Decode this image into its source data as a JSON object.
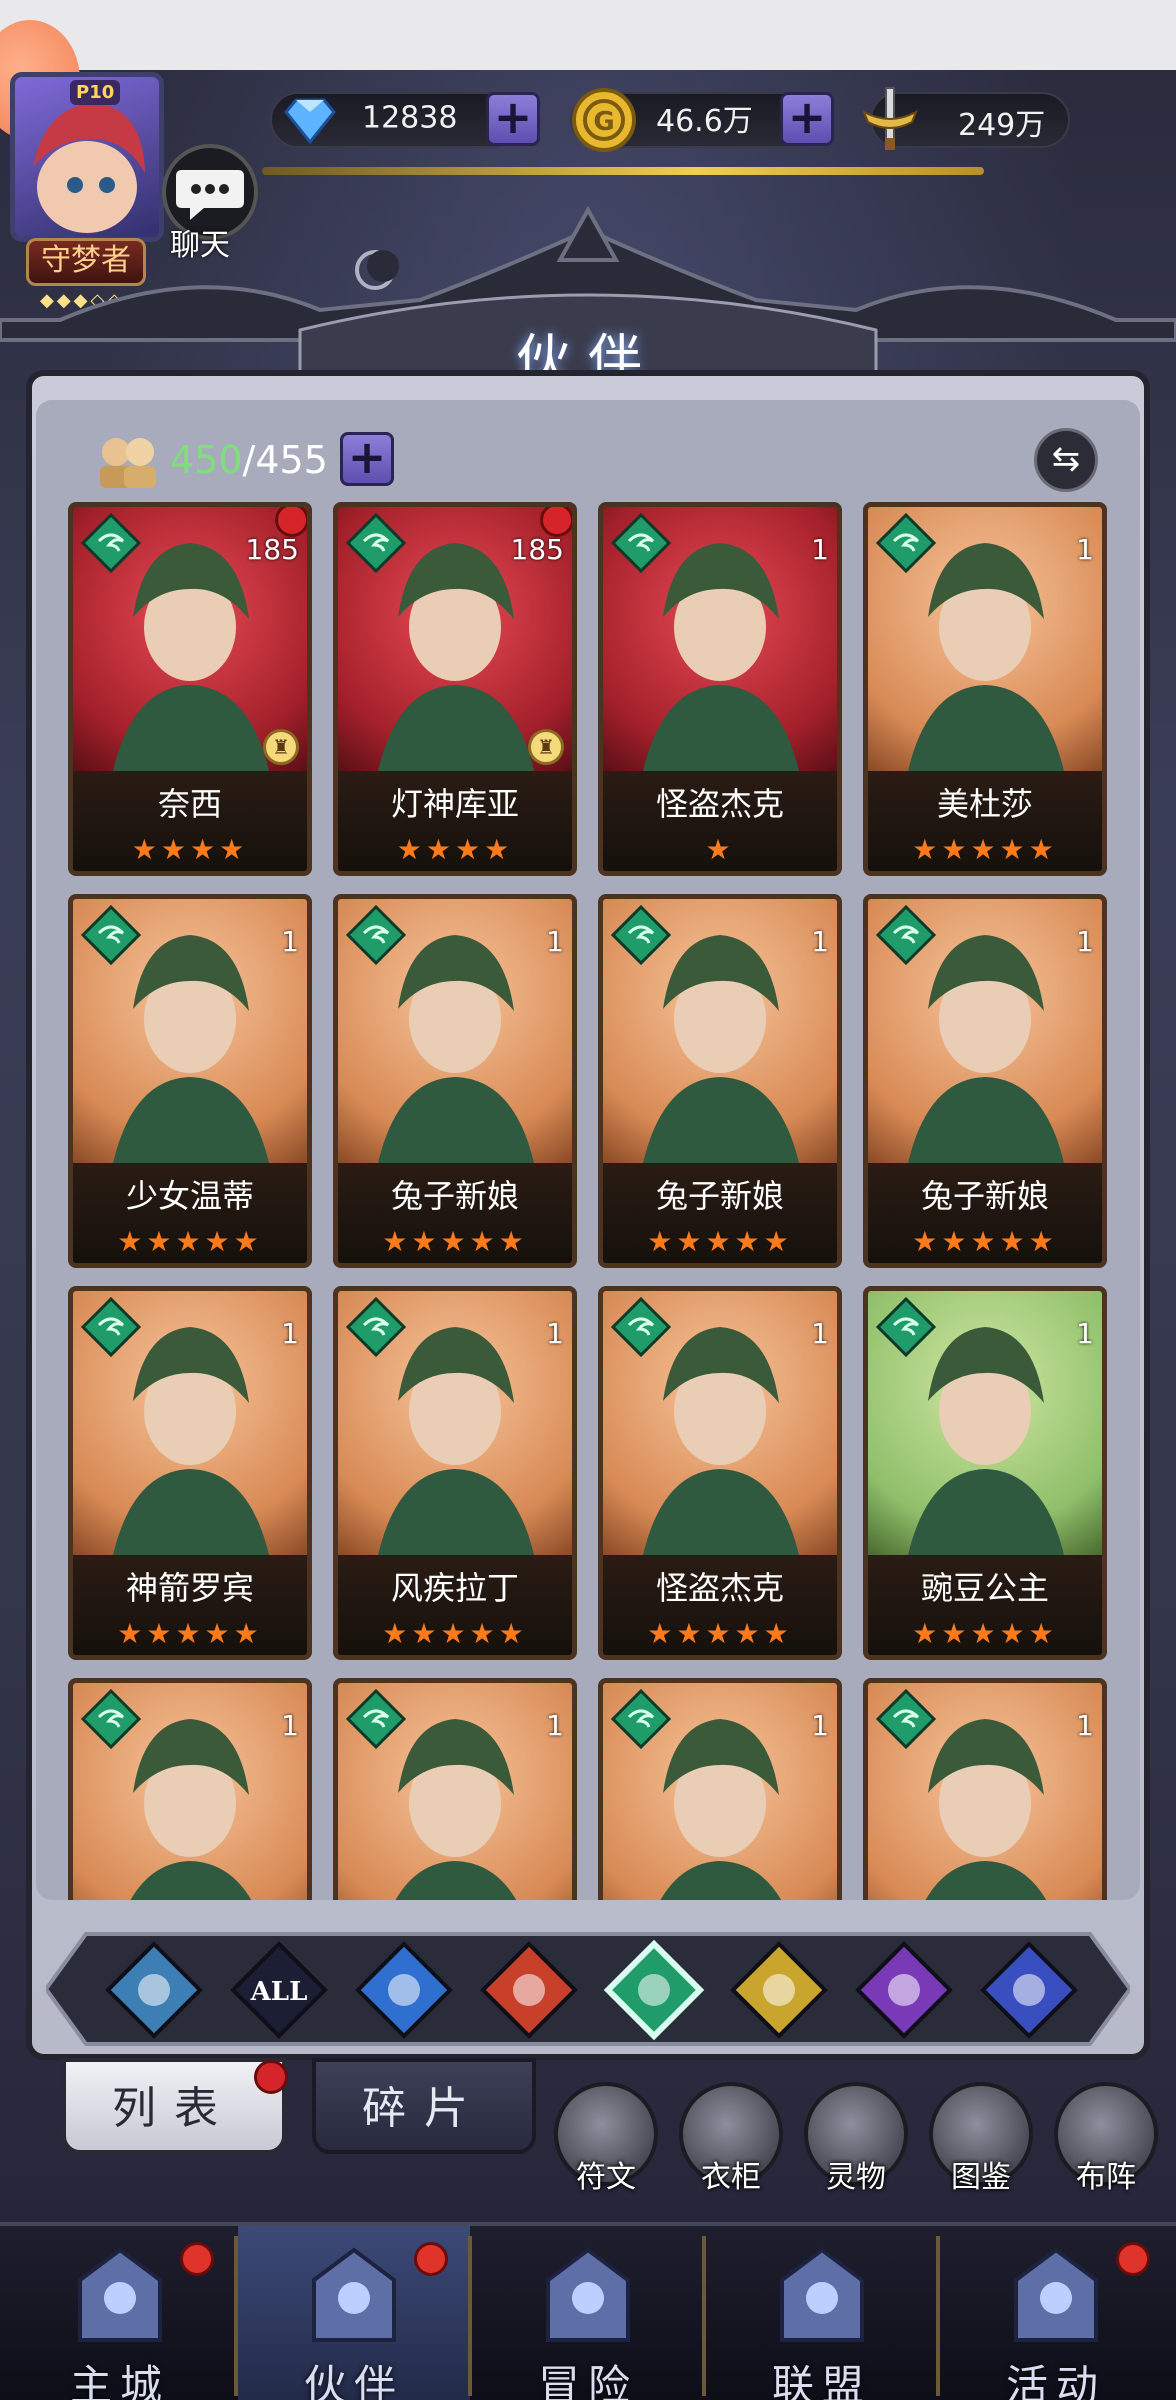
{
  "resources": {
    "diamonds": "12838",
    "gold": "46.6万",
    "power": "249万",
    "power_progress": 0.88
  },
  "player": {
    "vip": "P10",
    "rank_title": "守梦者"
  },
  "chat": {
    "label": "聊天"
  },
  "panel": {
    "title": "伙伴"
  },
  "roster": {
    "owned": "450",
    "capacity": "/455"
  },
  "heroes": [
    {
      "name": "奈西",
      "level": "185",
      "stars": 4,
      "portrait": "crimson",
      "red_dot": true,
      "rank_badge": true
    },
    {
      "name": "灯神库亚",
      "level": "185",
      "stars": 4,
      "portrait": "crimson",
      "red_dot": true,
      "rank_badge": true
    },
    {
      "name": "怪盗杰克",
      "level": "1",
      "stars": 1,
      "portrait": "crimson",
      "red_dot": false,
      "rank_badge": false
    },
    {
      "name": "美杜莎",
      "level": "1",
      "stars": 5,
      "portrait": "amber",
      "red_dot": false,
      "rank_badge": false
    },
    {
      "name": "少女温蒂",
      "level": "1",
      "stars": 5,
      "portrait": "amber",
      "red_dot": false,
      "rank_badge": false
    },
    {
      "name": "兔子新娘",
      "level": "1",
      "stars": 5,
      "portrait": "amber",
      "red_dot": false,
      "rank_badge": false
    },
    {
      "name": "兔子新娘",
      "level": "1",
      "stars": 5,
      "portrait": "amber",
      "red_dot": false,
      "rank_badge": false
    },
    {
      "name": "兔子新娘",
      "level": "1",
      "stars": 5,
      "portrait": "amber",
      "red_dot": false,
      "rank_badge": false
    },
    {
      "name": "神箭罗宾",
      "level": "1",
      "stars": 5,
      "portrait": "amber",
      "red_dot": false,
      "rank_badge": false
    },
    {
      "name": "风疾拉丁",
      "level": "1",
      "stars": 5,
      "portrait": "amber",
      "red_dot": false,
      "rank_badge": false
    },
    {
      "name": "怪盗杰克",
      "level": "1",
      "stars": 5,
      "portrait": "amber",
      "red_dot": false,
      "rank_badge": false
    },
    {
      "name": "豌豆公主",
      "level": "1",
      "stars": 5,
      "portrait": "green",
      "red_dot": false,
      "rank_badge": false
    },
    {
      "name": "",
      "level": "1",
      "stars": 0,
      "portrait": "amber",
      "red_dot": false,
      "rank_badge": false
    },
    {
      "name": "",
      "level": "1",
      "stars": 0,
      "portrait": "amber",
      "red_dot": false,
      "rank_badge": false
    },
    {
      "name": "",
      "level": "1",
      "stars": 0,
      "portrait": "amber",
      "red_dot": false,
      "rank_badge": false
    },
    {
      "name": "",
      "level": "1",
      "stars": 0,
      "portrait": "amber",
      "red_dot": false,
      "rank_badge": false
    }
  ],
  "filters": [
    {
      "id": "shield",
      "color": "#3d7fb5",
      "label": "",
      "active": false
    },
    {
      "id": "all",
      "color": "#1c1f33",
      "label": "ALL",
      "active": false
    },
    {
      "id": "water",
      "color": "#2f6fd0",
      "label": "",
      "active": false
    },
    {
      "id": "fire",
      "color": "#c8402a",
      "label": "",
      "active": false
    },
    {
      "id": "wind",
      "color": "#1f9c6a",
      "label": "",
      "active": true
    },
    {
      "id": "light",
      "color": "#c9a52e",
      "label": "",
      "active": false
    },
    {
      "id": "moon",
      "color": "#7a3ab8",
      "label": "",
      "active": false
    },
    {
      "id": "planet",
      "color": "#3a4fbf",
      "label": "",
      "active": false
    }
  ],
  "subtabs": {
    "list": "列表",
    "fragments": "碎片"
  },
  "functions": [
    "符文",
    "衣柜",
    "灵物",
    "图鉴",
    "布阵"
  ],
  "nav": [
    {
      "label": "主城",
      "dot": true,
      "active": false
    },
    {
      "label": "伙伴",
      "dot": true,
      "active": true
    },
    {
      "label": "冒险",
      "dot": false,
      "active": false
    },
    {
      "label": "联盟",
      "dot": false,
      "active": false
    },
    {
      "label": "活动",
      "dot": true,
      "active": false
    }
  ],
  "colors": {
    "star": "#ff7a1a",
    "wind_gem": "#1f9c6a",
    "owned_count": "#7fe07a",
    "accent_plus": "#6f5fc4"
  }
}
